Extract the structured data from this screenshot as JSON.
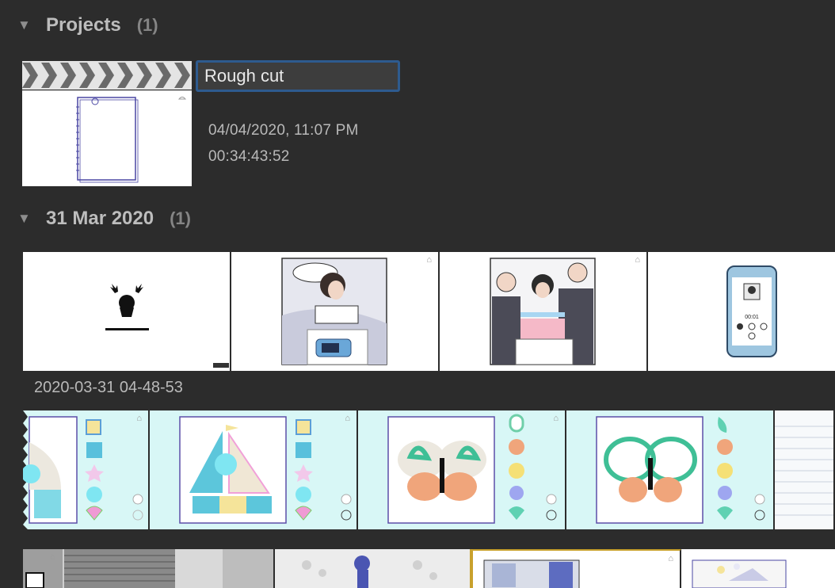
{
  "sections": {
    "projects": {
      "label": "Projects",
      "count": "(1)"
    },
    "event": {
      "label": "31 Mar 2020",
      "count": "(1)"
    }
  },
  "project": {
    "name_value": "Rough cut",
    "date": "04/04/2020, 11:07 PM",
    "duration": "00:34:43:52"
  },
  "clip_label": "2020-03-31 04-48-53",
  "thumbnail": {
    "phone_label_1": "00:01"
  },
  "icons": {
    "disclosure": "disclosure-triangle-icon",
    "cloud": "cloud-icon"
  },
  "colors": {
    "background": "#2c2c2c",
    "focus_ring": "#2e5b8f",
    "selection": "#c8a12d",
    "aqua_bg": "#d8f7f6"
  }
}
